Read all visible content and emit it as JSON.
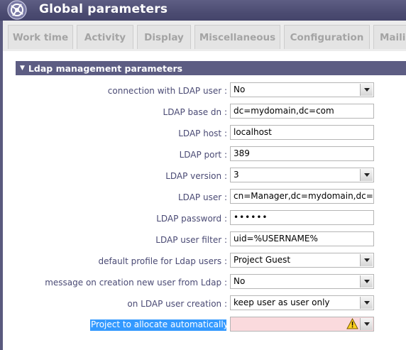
{
  "app": {
    "title": "Global parameters"
  },
  "tabs": [
    {
      "label": "Work time"
    },
    {
      "label": "Activity"
    },
    {
      "label": "Display"
    },
    {
      "label": "Miscellaneous"
    },
    {
      "label": "Configuration"
    },
    {
      "label": "Maili"
    }
  ],
  "section": {
    "title": "Ldap management parameters"
  },
  "fields": {
    "connection": {
      "label": "connection with LDAP user :",
      "value": "No"
    },
    "base_dn": {
      "label": "LDAP base dn :",
      "value": "dc=mydomain,dc=com"
    },
    "host": {
      "label": "LDAP host :",
      "value": "localhost"
    },
    "port": {
      "label": "LDAP port :",
      "value": "389"
    },
    "version": {
      "label": "LDAP version :",
      "value": "3"
    },
    "user": {
      "label": "LDAP user :",
      "value": "cn=Manager,dc=mydomain,dc=com"
    },
    "password": {
      "label": "LDAP password :",
      "value": "••••••"
    },
    "user_filter": {
      "label": "LDAP user filter :",
      "value": "uid=%USERNAME%"
    },
    "default_profile": {
      "label": "default profile for Ldap users :",
      "value": "Project Guest"
    },
    "message_creation": {
      "label": "message on creation new user from Ldap :",
      "value": "No"
    },
    "on_creation": {
      "label": "on LDAP user creation :",
      "value": "keep user as user only"
    },
    "project_allocate": {
      "label": "Project to allocate automatically :",
      "value": ""
    }
  },
  "icons": {
    "logo": "app-logo-icon",
    "warning": "warning-icon",
    "dropdown": "chevron-down-icon"
  },
  "colors": {
    "header": "#4c4c72",
    "section": "#5d5d83",
    "label": "#4a4a74",
    "highlight": "#3399ff",
    "warning_field": "#fadadd"
  }
}
